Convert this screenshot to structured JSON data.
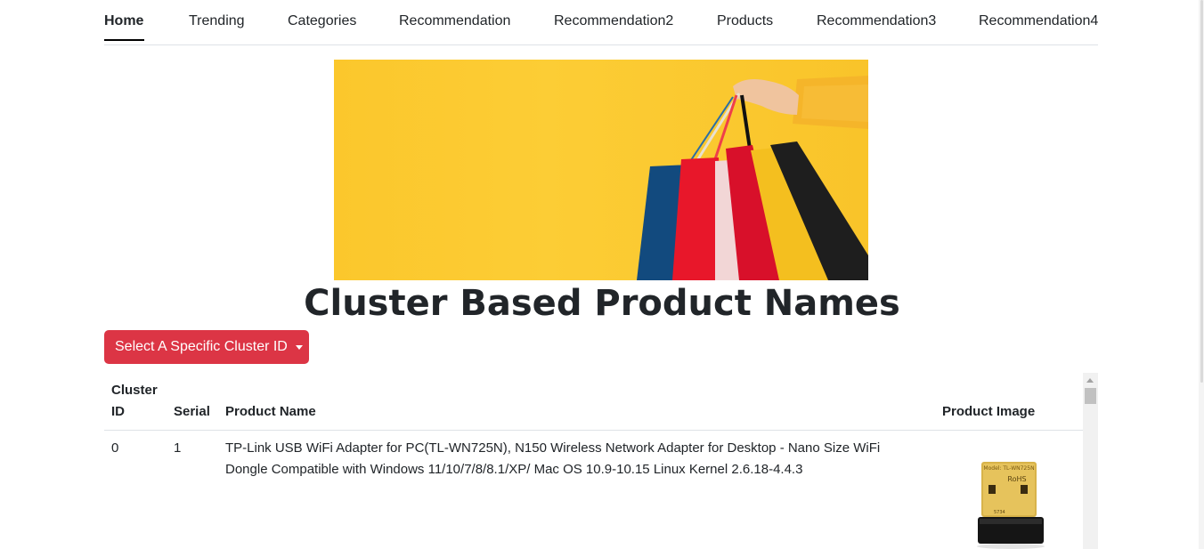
{
  "nav": {
    "items": [
      {
        "label": "Home",
        "active": true
      },
      {
        "label": "Trending",
        "active": false
      },
      {
        "label": "Categories",
        "active": false
      },
      {
        "label": "Recommendation",
        "active": false
      },
      {
        "label": "Recommendation2",
        "active": false
      },
      {
        "label": "Products",
        "active": false
      },
      {
        "label": "Recommendation3",
        "active": false
      },
      {
        "label": "Recommendation4",
        "active": false
      }
    ]
  },
  "banner": {
    "image_desc": "shopping-bags-banner",
    "background_color": "#fccd35"
  },
  "page_title": "Cluster Based Product Names",
  "dropdown": {
    "label": "Select A Specific Cluster ID",
    "color": "#dc3545"
  },
  "table": {
    "headers": {
      "cluster_line1": "Cluster",
      "cluster_line2": "ID",
      "serial": "Serial",
      "product_name": "Product Name",
      "product_image": "Product Image"
    },
    "rows": [
      {
        "cluster_id": "0",
        "serial": "1",
        "product_name_line1": "TP-Link USB WiFi Adapter for PC(TL-WN725N), N150 Wireless Network Adapter for Desktop - Nano Size WiFi",
        "product_name_line2": "Dongle Compatible with Windows 11/10/7/8/8.1/XP/ Mac OS 10.9-10.15 Linux Kernel 2.6.18-4.4.3",
        "image_desc": "usb-wifi-adapter",
        "image_model_text": "Model: TL-WN725N",
        "image_rohs_text": "RoHS",
        "image_code_text": "5734"
      }
    ]
  }
}
